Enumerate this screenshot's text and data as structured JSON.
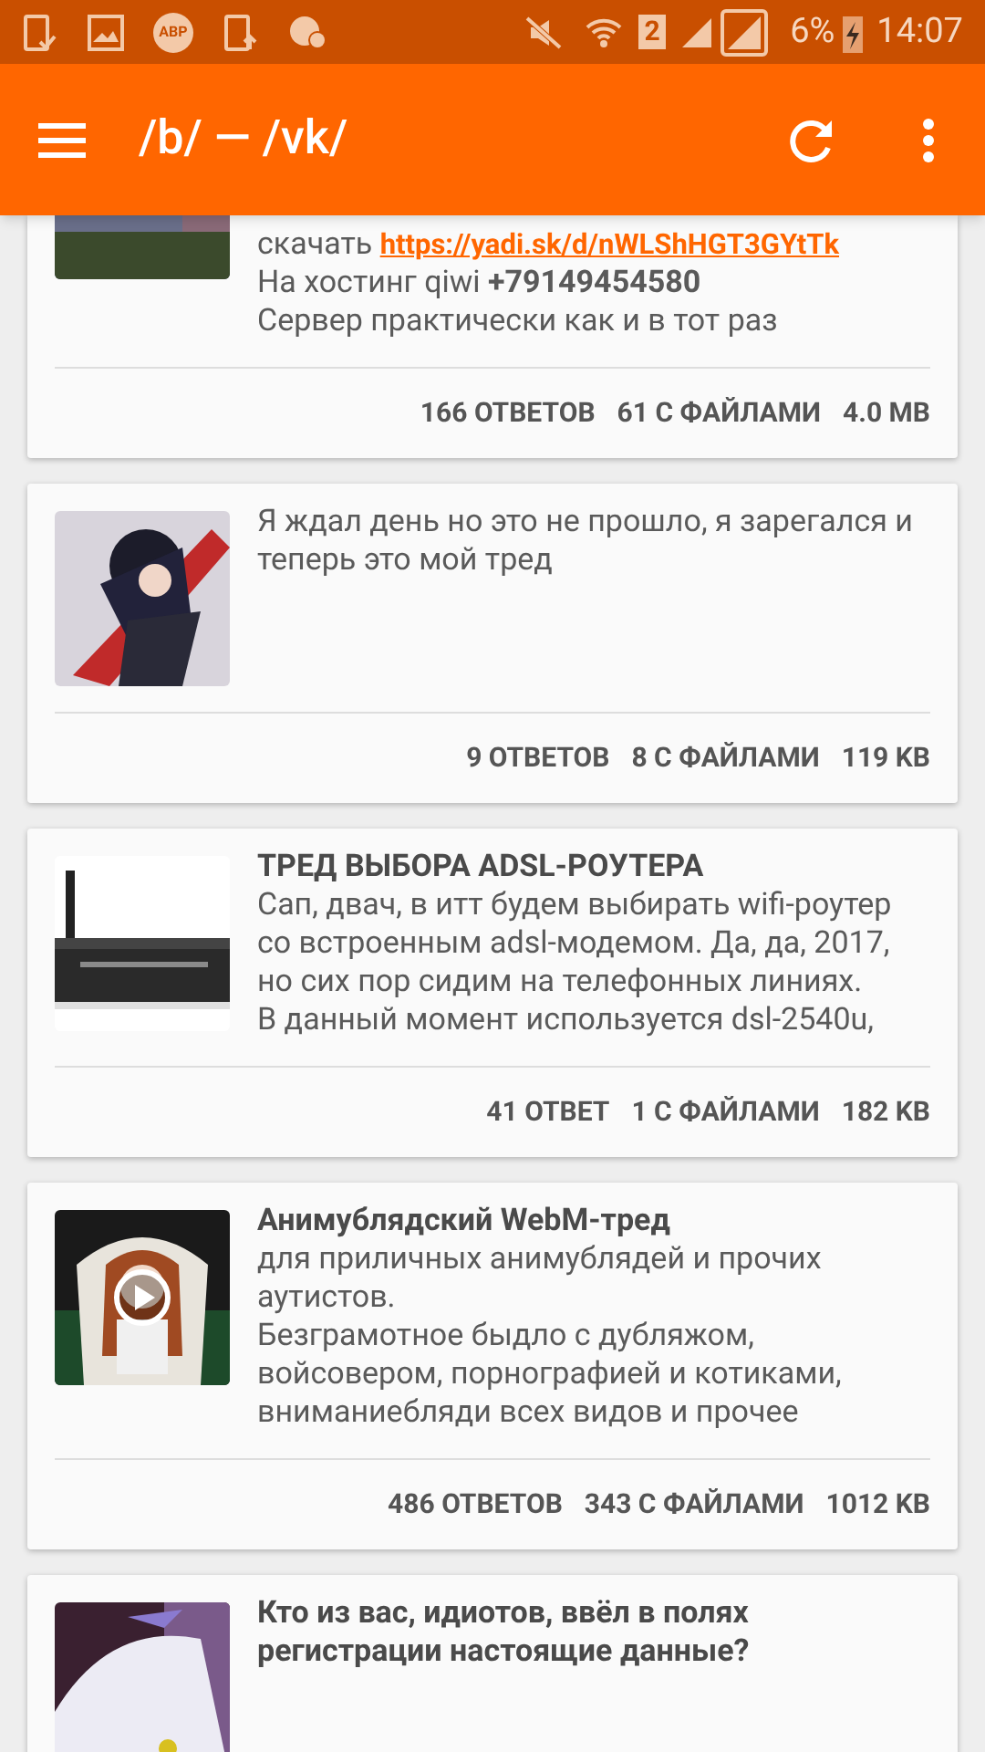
{
  "status_bar": {
    "adblock_badge": "ABP",
    "sim_slot": "2",
    "battery": "6%",
    "time": "14:07"
  },
  "app_bar": {
    "title": "/b/ — /vk/"
  },
  "threads": [
    {
      "cut_top": true,
      "video": false,
      "body": [
        {
          "text": "скачать ",
          "link": "https://yadi.sk/d/nWLShHGT3GYtTk"
        },
        {
          "text": "На хостинг qiwi **+79149454580**"
        },
        {
          "text": "Сервер практически как и в тот раз"
        }
      ],
      "stats": [
        "166 ОТВЕТОВ",
        "61 С ФАЙЛАМИ",
        "4.0 MB"
      ]
    },
    {
      "cut_top": false,
      "video": false,
      "body": [
        {
          "text": "Я ждал день но это не прошло, я зарегался и теперь это мой тред"
        }
      ],
      "stats": [
        "9 ОТВЕТОВ",
        "8 С ФАЙЛАМИ",
        "119 KB"
      ]
    },
    {
      "cut_top": false,
      "video": false,
      "title": "ТРЕД ВЫБОРА ADSL-РОУТЕРА",
      "body": [
        {
          "text": "Сап, двач, в итт будем выбирать wifi-роутер со встроенным adsl-модемом. Да, да, 2017, но сих пор сидим на телефонных линиях."
        },
        {
          "text": "В данный момент используется dsl-2540u,"
        }
      ],
      "stats": [
        "41 ОТВЕТ",
        "1 С ФАЙЛАМИ",
        "182 KB"
      ]
    },
    {
      "cut_top": false,
      "video": true,
      "title": "Анимублядский WebM-тред",
      "body": [
        {
          "text": "для приличных анимублядей и прочих аутистов."
        },
        {
          "text": "Безграмотное быдло с дубляжом, войсовером, порнографией и котиками, вниманиебляди всех видов и прочее"
        }
      ],
      "stats": [
        "486 ОТВЕТОВ",
        "343 С ФАЙЛАМИ",
        "1012 KB"
      ]
    },
    {
      "cut_top": false,
      "video": false,
      "title": "Кто из вас, идиотов, ввёл в полях регистрации настоящие данные?"
    }
  ]
}
